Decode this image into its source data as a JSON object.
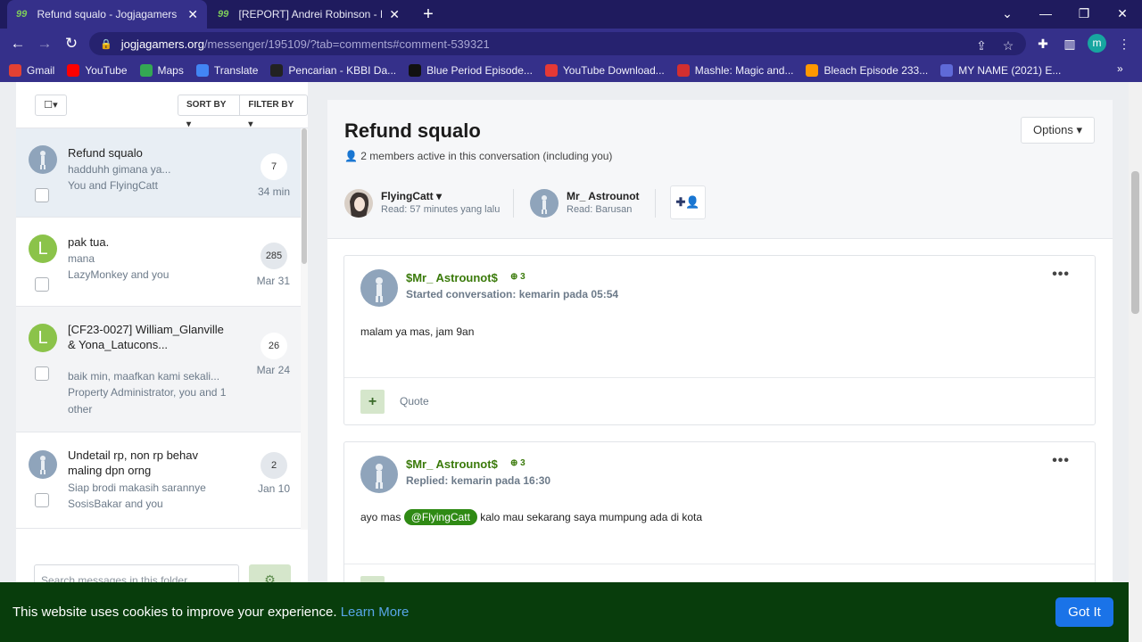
{
  "browser": {
    "tabs": [
      {
        "label": "Refund squalo - Jogjagamers Co"
      },
      {
        "label": "[REPORT] Andrei Robinson - Pag"
      }
    ],
    "favicon_text": "99",
    "url_host": "jogjagamers.org",
    "url_path": "/messenger/195109/?tab=comments#comment-539321",
    "profile_letter": "m",
    "bookmarks": [
      {
        "label": "Gmail",
        "icon": "gmail-icon",
        "color": "#e34133"
      },
      {
        "label": "YouTube",
        "icon": "youtube-icon",
        "color": "#ff0000"
      },
      {
        "label": "Maps",
        "icon": "maps-icon",
        "color": "#34a853"
      },
      {
        "label": "Translate",
        "icon": "translate-icon",
        "color": "#4285f4"
      },
      {
        "label": "Pencarian - KBBI Da...",
        "icon": "kbbi-icon",
        "color": "#222222"
      },
      {
        "label": "Blue Period Episode...",
        "icon": "blue-period-icon",
        "color": "#111111"
      },
      {
        "label": "YouTube Download...",
        "icon": "download-icon",
        "color": "#e53935"
      },
      {
        "label": "Mashle: Magic and...",
        "icon": "mashle-icon",
        "color": "#d32f2f"
      },
      {
        "label": "Bleach Episode 233...",
        "icon": "bleach-icon",
        "color": "#ff9800"
      },
      {
        "label": "MY NAME (2021) E...",
        "icon": "calendar-icon",
        "color": "#5f6ad8"
      }
    ]
  },
  "sidebar": {
    "sort_label": "SORT BY",
    "filter_label": "FILTER BY",
    "conversations": [
      {
        "title": "Refund squalo",
        "snippet": "hadduhh gimana ya...",
        "participants": "You and FlyingCatt",
        "count": "7",
        "date": "34 min"
      },
      {
        "title": "pak tua.",
        "snippet": "mana",
        "participants": "LazyMonkey and you",
        "count": "285",
        "date": "Mar 31",
        "avatar_letter": "L"
      },
      {
        "title": "[CF23-0027] William_Glanville & Yona_Latucons...",
        "snippet": "baik min, maafkan kami sekali...",
        "participants": "Property Administrator, you and 1 other",
        "count": "26",
        "date": "Mar 24",
        "avatar_letter": "L"
      },
      {
        "title": "Undetail rp, non rp behav maling dpn orng",
        "snippet": "Siap brodi makasih sarannye",
        "participants": "SosisBakar and you",
        "count": "2",
        "date": "Jan 10"
      }
    ],
    "search_placeholder": "Search messages in this folder"
  },
  "conversation": {
    "title": "Refund squalo",
    "meta": "2 members active in this conversation (including you)",
    "options_label": "Options",
    "members": [
      {
        "name": "FlyingCatt",
        "read": "Read: 57 minutes yang lalu"
      },
      {
        "name": "Mr_ Astrounot",
        "read": "Read: Barusan"
      }
    ],
    "messages": [
      {
        "author": "$Mr_ Astrounot$",
        "reputation": "3",
        "when": "Started conversation: kemarin pada 05:54",
        "body": "malam ya mas, jam 9an",
        "quote_label": "Quote"
      },
      {
        "author": "$Mr_ Astrounot$",
        "reputation": "3",
        "when": "Replied: kemarin pada 16:30",
        "body_before": "ayo mas",
        "mention": "@FlyingCatt",
        "body_after": "kalo mau sekarang saya mumpung ada di kota"
      }
    ]
  },
  "cookie": {
    "text": "This website uses cookies to improve your experience.",
    "learn_more": "Learn More",
    "button": "Got It"
  },
  "colors": {
    "brand_green": "#3a7a0a",
    "cookie_bg": "#083d0c",
    "accent_blue": "#1a73e8",
    "chrome": "#35308a"
  }
}
